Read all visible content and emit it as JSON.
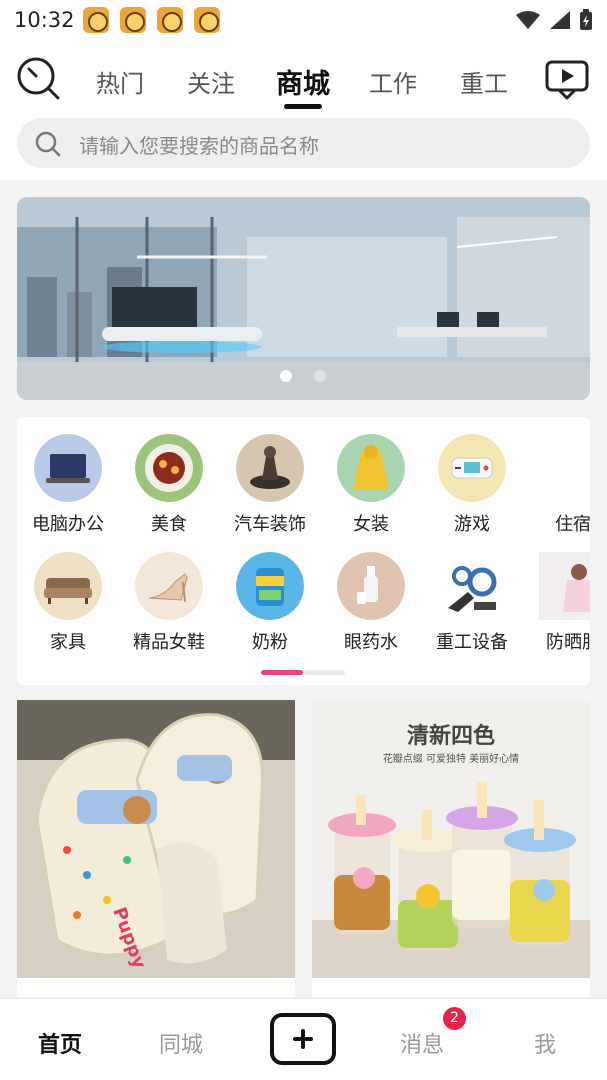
{
  "status_bar": {
    "time": "10:32",
    "notification_icons": [
      "app-notification-icon",
      "app-notification-icon",
      "app-notification-icon",
      "app-notification-icon"
    ],
    "system_icons": [
      "wifi-icon",
      "cellular-signal-icon",
      "battery-charging-icon"
    ]
  },
  "top_nav": {
    "tabs": [
      {
        "label": "热门",
        "active": false
      },
      {
        "label": "关注",
        "active": false
      },
      {
        "label": "商城",
        "active": true
      },
      {
        "label": "工作",
        "active": false
      },
      {
        "label": "重工",
        "active": false
      }
    ]
  },
  "search": {
    "placeholder": "请输入您要搜索的商品名称"
  },
  "banner": {
    "slide_count": 2,
    "active_index": 0
  },
  "categories": {
    "row1": [
      {
        "label": "电脑办公",
        "icon": "laptop-icon"
      },
      {
        "label": "美食",
        "icon": "food-plate-icon"
      },
      {
        "label": "汽车装饰",
        "icon": "car-decoration-icon"
      },
      {
        "label": "女装",
        "icon": "raincoat-icon"
      },
      {
        "label": "游戏",
        "icon": "handheld-game-icon"
      },
      {
        "label": "住宿",
        "icon": "hotel-icon"
      }
    ],
    "row2": [
      {
        "label": "家具",
        "icon": "sofa-icon"
      },
      {
        "label": "精品女鞋",
        "icon": "high-heel-icon"
      },
      {
        "label": "奶粉",
        "icon": "milk-powder-icon"
      },
      {
        "label": "眼药水",
        "icon": "eye-drops-icon"
      },
      {
        "label": "重工设备",
        "icon": "heavy-machinery-icon"
      },
      {
        "label": "防晒服",
        "icon": "sun-protection-clothing-icon"
      }
    ],
    "scroll_progress": 0.5
  },
  "products": [
    {
      "image_text": "Puppy",
      "icon": "slippers-image"
    },
    {
      "title": "清新四色",
      "subtitle": "花瓣点缀 可爱独特 美丽好心情",
      "icon": "drink-cups-image"
    }
  ],
  "bottom_bar": {
    "items": [
      {
        "label": "首页",
        "active": true
      },
      {
        "label": "同城",
        "active": false
      },
      {
        "label": "消息",
        "active": false,
        "badge": "2"
      },
      {
        "label": "我",
        "active": false
      }
    ]
  },
  "colors": {
    "accent": "#e5457a",
    "badge": "#e8234a",
    "active_text": "#111111",
    "inactive_text": "#9a9a9a"
  }
}
